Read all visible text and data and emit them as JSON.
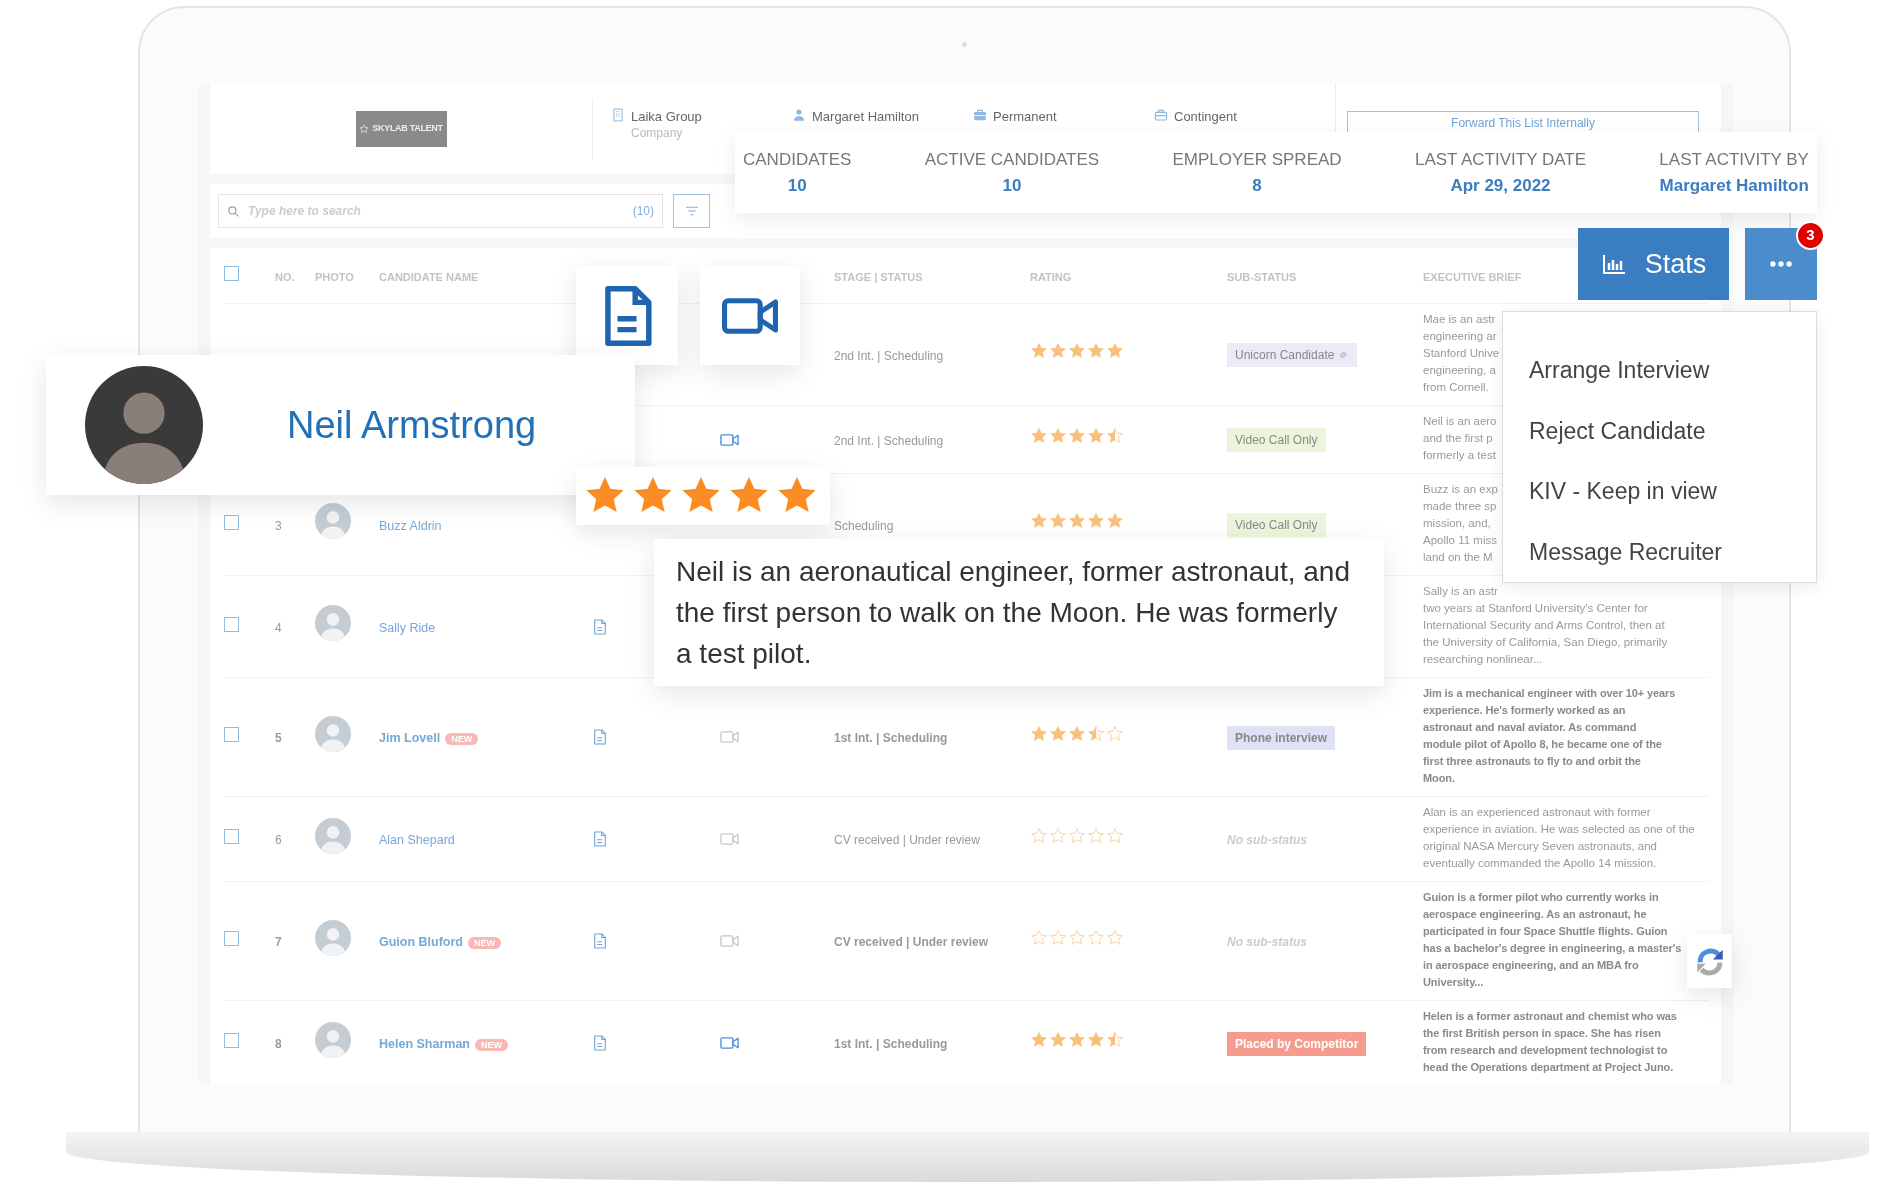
{
  "header": {
    "logo": "SKYLAB TALENT",
    "info": [
      {
        "kind": "company",
        "label": "Laika Group",
        "sublabel": "Company"
      },
      {
        "kind": "person",
        "label": "Margaret Hamilton"
      },
      {
        "kind": "job",
        "label": "Permanent"
      },
      {
        "kind": "contract",
        "label": "Contingent"
      }
    ],
    "forward_button": "Forward This List Internally"
  },
  "search": {
    "placeholder": "Type here to search",
    "count": "(10)"
  },
  "stats": [
    {
      "label": "CANDIDATES",
      "value": "10"
    },
    {
      "label": "ACTIVE CANDIDATES",
      "value": "10"
    },
    {
      "label": "EMPLOYER SPREAD",
      "value": "8"
    },
    {
      "label": "LAST ACTIVITY DATE",
      "value": "Apr 29, 2022"
    },
    {
      "label": "LAST ACTIVITY BY",
      "value": "Margaret Hamilton"
    }
  ],
  "actions": {
    "stats_button": "Stats",
    "more_badge": "3"
  },
  "menu": [
    "Arrange Interview",
    "Reject Candidate",
    "KIV - Keep in view",
    "Message Recruiter"
  ],
  "table": {
    "header": {
      "checked": false,
      "columns": [
        "NO.",
        "PHOTO",
        "CANDIDATE NAME",
        "STAGE | STATUS",
        "RATING",
        "SUB-STATUS",
        "EXECUTIVE BRIEF"
      ]
    },
    "rows": [
      {
        "unread": false,
        "stage": "2nd Int. | Scheduling",
        "stars": 5,
        "sub_status": {
          "kind": "special",
          "label": "Unicorn Candidate",
          "color": "#ebebf8"
        },
        "brief": [
          "Mae is an astr",
          "engineering ar",
          "Stanford Unive",
          "engineering, a",
          "from Cornell."
        ]
      },
      {
        "unread": false,
        "video_on": true,
        "stage": "2nd Int. | Scheduling",
        "stars": 4.5,
        "sub_status": {
          "kind": "tag",
          "label": "Video Call Only",
          "color": "#eaf5dc"
        },
        "brief": [
          "Neil is an aero",
          "and the first p",
          "formerly a test"
        ]
      },
      {
        "checked": false,
        "number": "3",
        "photo": true,
        "name": "Buzz Aldrin",
        "unread": false,
        "stage": "Scheduling",
        "stars": 5,
        "sub_status": {
          "kind": "tag",
          "label": "Video Call Only",
          "color": "#eaf5dc"
        },
        "brief": [
          "Buzz is an exp",
          "made three sp",
          "mission, and,",
          "Apollo 11 miss",
          "land on the M"
        ]
      },
      {
        "checked": false,
        "number": "4",
        "photo": true,
        "name": "Sally Ride",
        "unread": false,
        "doc": true,
        "brief": [
          "Sally is an astr",
          "two years at Stanford University's Center for",
          "International Security and Arms Control, then at",
          "the University of California, San Diego, primarily",
          "researching nonlinear..."
        ]
      },
      {
        "checked": false,
        "number": "5",
        "photo": true,
        "name": "Jim Lovell",
        "badge": "NEW",
        "unread": true,
        "doc": true,
        "video_on": false,
        "stage": "1st Int. | Scheduling",
        "stars": 3.5,
        "sub_status": {
          "kind": "tag",
          "label": "Phone interview",
          "color": "#dfe1f5"
        },
        "brief": [
          "Jim is a mechanical engineer with over 10+ years",
          "experience. He's formerly worked as an",
          "astronaut and naval aviator. As command",
          "module pilot of Apollo 8, he became one of the",
          "first three astronauts to fly to and orbit the",
          "Moon."
        ]
      },
      {
        "checked": false,
        "number": "6",
        "photo": true,
        "name": "Alan Shepard",
        "unread": false,
        "doc": true,
        "video_on": false,
        "stage": "CV received | Under review",
        "stars": 0,
        "sub_status": {
          "kind": "none",
          "label": "No sub-status"
        },
        "brief": [
          "Alan is an experienced astronaut with former",
          "experience in aviation. He was selected as one of the",
          "original NASA Mercury Seven astronauts, and",
          "eventually commanded the Apollo 14 mission."
        ]
      },
      {
        "checked": false,
        "number": "7",
        "photo": true,
        "name": "Guion Bluford",
        "badge": "NEW",
        "unread": true,
        "doc": true,
        "video_on": false,
        "stage": "CV received | Under review",
        "stars": 0,
        "sub_status": {
          "kind": "none",
          "label": "No sub-status"
        },
        "brief": [
          "Guion is a former pilot who currently works in",
          "aerospace engineering. As an astronaut, he",
          "participated in four Space Shuttle flights. Guion",
          "has a bachelor's degree in engineering, a master's",
          "in aerospace engineering, and an MBA fro",
          "University..."
        ]
      },
      {
        "checked": false,
        "number": "8",
        "photo": true,
        "name": "Helen Sharman",
        "badge": "NEW",
        "unread": true,
        "doc": true,
        "video_on": true,
        "stage": "1st Int. | Scheduling",
        "stars": 4.5,
        "sub_status": {
          "kind": "tag",
          "label": "Placed by Competitor",
          "color": "#f59c8f"
        },
        "brief": [
          "Helen is a former astronaut and chemist who was",
          "the first British person in space. She has risen",
          "from research and development technologist to",
          "head the Operations department at Project Juno."
        ]
      }
    ]
  },
  "spotlight": {
    "name": "Neil Armstrong",
    "stars": 5,
    "brief": "Neil is an aeronautical engineer, former astronaut, and the first person to walk on the Moon. He was formerly a test pilot."
  }
}
